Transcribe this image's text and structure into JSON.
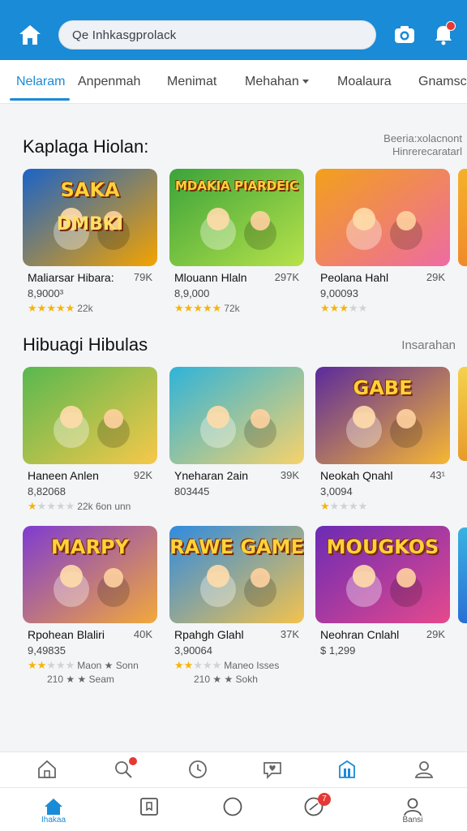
{
  "search": {
    "text": "Qe  Inhkasgprolack"
  },
  "tabs": [
    {
      "label": "Nelaram",
      "active": true
    },
    {
      "label": "Anpenmah"
    },
    {
      "label": "Menimat"
    },
    {
      "label": "Mehahan"
    },
    {
      "label": "Moalaura"
    },
    {
      "label": "Gnamsc"
    }
  ],
  "sections": [
    {
      "title": "Kaplaga Hiolan:",
      "link_line1": "Beeria:xolacnont",
      "link_line2": "Hinrerecaratarl",
      "cards": [
        {
          "title": "Maliarsar Hibara:",
          "count": "79K",
          "sub": "8,9000³",
          "rating_text": "22k",
          "stars": 5
        },
        {
          "title": "Mlouann Hlaln",
          "count": "297K",
          "sub": "8,9,000",
          "rating_text": "72k",
          "stars": 5
        },
        {
          "title": "Peolana Hahl",
          "count": "29K",
          "sub": "9,00093",
          "rating_text": "",
          "stars": 3
        }
      ]
    },
    {
      "title": "Hibuagi  Hibulas",
      "link": "Insarahan",
      "cards": [
        {
          "title": "Haneen Anlen",
          "count": "92K",
          "sub": "8,82068",
          "rating_text": "22k 6on unn",
          "stars": 1
        },
        {
          "title": "Yneharan 2ain",
          "count": "39K",
          "sub": "803445",
          "rating_text": "",
          "stars": 0
        },
        {
          "title": "Neokah Qnahl",
          "count": "43¹",
          "sub": "3,0094",
          "rating_text": "",
          "stars": 1
        }
      ]
    },
    {
      "cards": [
        {
          "title": "Rpohean Blaliri",
          "count": "40K",
          "sub": "9,49835",
          "rating_text": "Maon ★ Sonn",
          "rating_text2": "210 ★ ★ Seam",
          "stars": 2
        },
        {
          "title": "Rpahgh Glahl",
          "count": "37K",
          "sub": "3,90064",
          "rating_text": "Maneo Isses",
          "rating_text2": "210 ★ ★ Sokh",
          "stars": 2
        },
        {
          "title": "Neohran Cnlahl",
          "count": "29K",
          "sub": "$ 1,299",
          "rating_text": "",
          "stars": 0
        }
      ]
    }
  ],
  "card_art": [
    {
      "text": "SAKA",
      "subtext": "DMBKI",
      "colors": [
        "#1b63c7",
        "#f4a300"
      ]
    },
    {
      "text": "MDAKIA PIARDEIC",
      "colors": [
        "#3aa33a",
        "#b7e24a"
      ]
    },
    {
      "text": "",
      "colors": [
        "#f2a01b",
        "#ee6ba3"
      ]
    },
    {
      "text": "",
      "colors": [
        "#58b84f",
        "#f7c84a"
      ]
    },
    {
      "text": "",
      "colors": [
        "#2fb3d9",
        "#f7d26b"
      ]
    },
    {
      "text": "GABE",
      "colors": [
        "#5b2a9c",
        "#f7b733"
      ]
    },
    {
      "text": "MARPY",
      "colors": [
        "#7f3bd1",
        "#f2a93b"
      ]
    },
    {
      "text": "RAWE GAME",
      "colors": [
        "#2f8be0",
        "#f3c24e"
      ]
    },
    {
      "text": "MOUGKOS",
      "colors": [
        "#6b2bb5",
        "#e5498c"
      ]
    },
    {
      "text": "",
      "colors": [
        "#3b8fe0",
        "#f09b3a"
      ]
    },
    {
      "text": "",
      "colors": [
        "#e7762a",
        "#f6d24e"
      ]
    },
    {
      "text": "",
      "colors": [
        "#3c2a6e",
        "#e46a3a"
      ]
    }
  ],
  "icon_bar": [
    "home-outline",
    "search",
    "clock",
    "heart-chat",
    "store",
    "user"
  ],
  "nav": [
    {
      "label": "Ihakaa",
      "icon": "home",
      "active": true
    },
    {
      "label": "",
      "icon": "bookmark"
    },
    {
      "label": "",
      "icon": "circle"
    },
    {
      "label": "",
      "icon": "chat",
      "badge": "7"
    },
    {
      "label": "Bansi",
      "icon": "user"
    }
  ],
  "colors": {
    "primary": "#1a8bd6",
    "badge": "#e53935",
    "star": "#f5b50a"
  }
}
